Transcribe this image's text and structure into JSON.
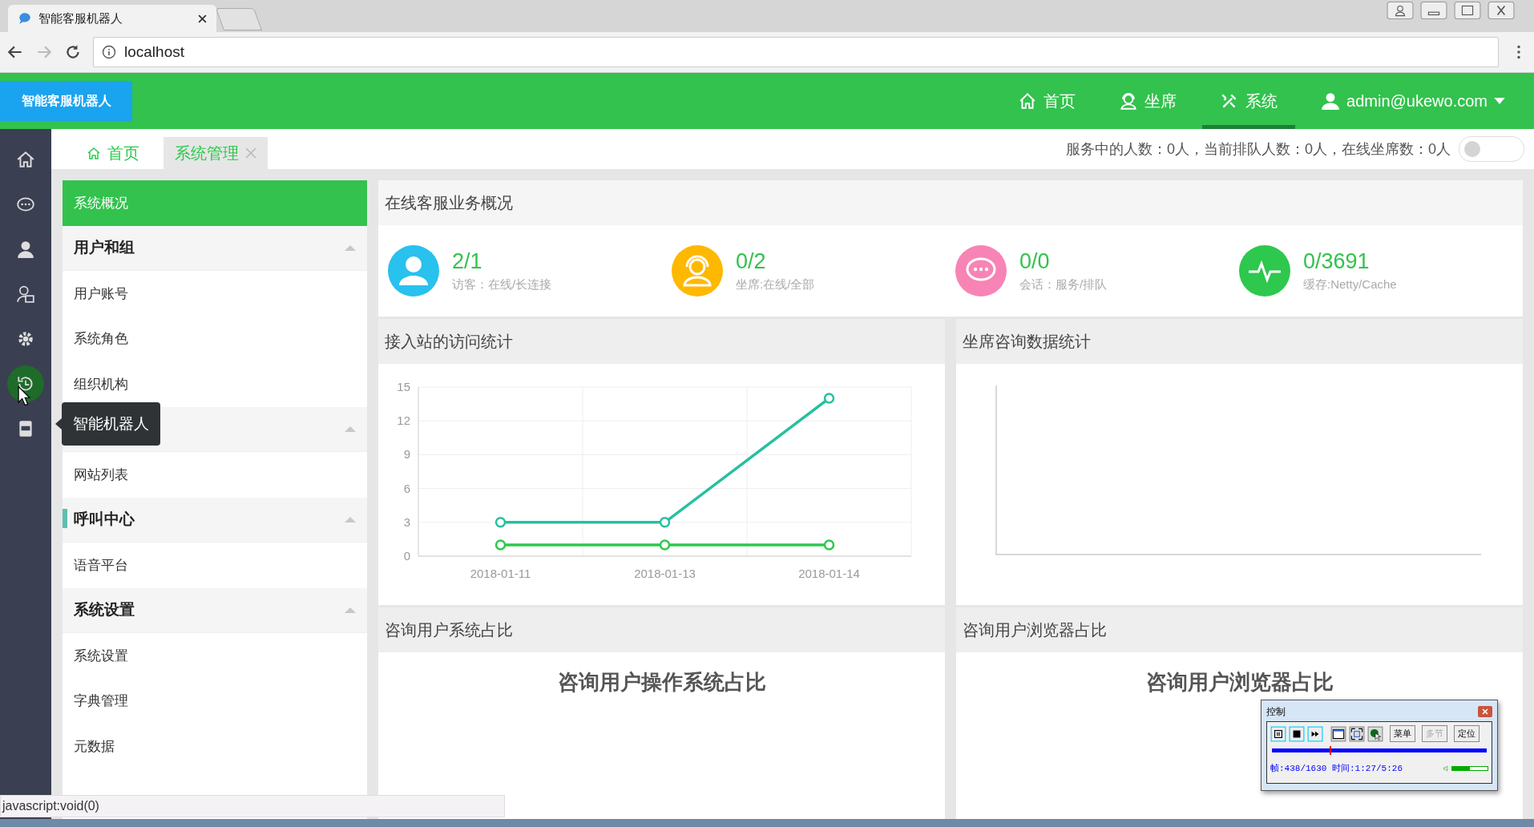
{
  "browser": {
    "tab_title": "智能客服机器人",
    "address": "localhost"
  },
  "header": {
    "logo": "智能客服机器人",
    "nav": [
      {
        "label": "首页",
        "selected": false
      },
      {
        "label": "坐席",
        "selected": false
      },
      {
        "label": "系统",
        "selected": true
      },
      {
        "label": "admin@ukewo.com",
        "selected": false
      }
    ]
  },
  "rail": [
    {
      "hovered": false
    },
    {
      "hovered": false
    },
    {
      "hovered": false
    },
    {
      "hovered": false
    },
    {
      "hovered": false
    },
    {
      "hovered": true
    },
    {
      "hovered": false
    }
  ],
  "tooltip": "智能机器人",
  "page_tabs": [
    {
      "label": "首页",
      "selected": false,
      "closable": false
    },
    {
      "label": "系统管理",
      "selected": true,
      "closable": true
    }
  ],
  "service_status": "服务中的人数：0人，当前排队人数：0人，在线坐席数：0人",
  "service_toggle": {
    "on": false
  },
  "menu": [
    {
      "kind": "link",
      "label": "系统概况",
      "selected": true
    },
    {
      "kind": "group",
      "label": "用户和组",
      "expanded": true,
      "highlighted": false,
      "children": [
        {
          "label": "用户账号"
        },
        {
          "label": "系统角色"
        },
        {
          "label": "组织机构"
        }
      ]
    },
    {
      "kind": "group",
      "expanded": true,
      "highlighted": false,
      "children": [
        {
          "label": "网站列表"
        }
      ]
    },
    {
      "kind": "group",
      "label": "呼叫中心",
      "expanded": true,
      "highlighted": true,
      "children": [
        {
          "label": "语音平台"
        }
      ]
    },
    {
      "kind": "group",
      "label": "系统设置",
      "expanded": true,
      "highlighted": false,
      "children": [
        {
          "label": "系统设置"
        },
        {
          "label": "字典管理"
        },
        {
          "label": "元数据"
        }
      ]
    }
  ],
  "overview": {
    "title": "在线客服业务概况",
    "stats": [
      {
        "value": "2/1",
        "label": "访客：在线/长连接",
        "color": "#29c1ee"
      },
      {
        "value": "0/2",
        "label": "坐席:在线/全部",
        "color": "#ffb800"
      },
      {
        "value": "0/0",
        "label": "会话：服务/排队",
        "color": "#f784b4"
      },
      {
        "value": "0/3691",
        "label": "缓存:Netty/Cache",
        "color": "#2dc84d"
      }
    ]
  },
  "visits": {
    "title": "接入站的访问统计",
    "chart_data": {
      "type": "line",
      "categories": [
        "2018-01-11",
        "2018-01-13",
        "2018-01-14"
      ],
      "yticks": [
        0,
        3,
        6,
        9,
        12,
        15
      ],
      "ylim": [
        0,
        15
      ],
      "grid": true,
      "series": [
        {
          "color": "#26c0a0",
          "marker": "circle",
          "values": [
            3,
            3,
            14
          ]
        },
        {
          "color": "#2dc84d",
          "marker": "circle",
          "values": [
            1,
            1,
            1
          ]
        }
      ]
    }
  },
  "agent_stats": {
    "title": "坐席咨询数据统计"
  },
  "os_share": {
    "title": "咨询用户系统占比",
    "chart_title": "咨询用户操作系统占比"
  },
  "browser_share": {
    "title": "咨询用户浏览器占比",
    "chart_title": "咨询用户浏览器占比"
  },
  "status_bar": "javascript:void(0)",
  "recorder": {
    "title": "控制",
    "buttons": [
      {
        "label": "菜单",
        "disabled": false
      },
      {
        "label": "多节",
        "disabled": true
      },
      {
        "label": "定位",
        "disabled": false
      }
    ],
    "progress": {
      "level": 0.27
    },
    "readout": "帧:438/1630 时间:1:27/5:26",
    "volume": {
      "level": 0.5
    }
  }
}
